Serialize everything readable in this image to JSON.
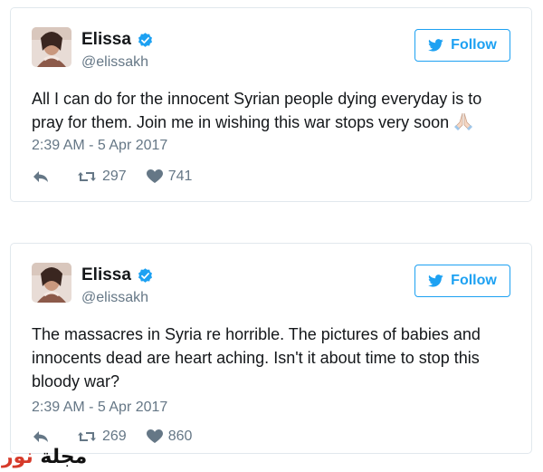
{
  "colors": {
    "accent": "#1da1f2",
    "secondary_text": "#657786",
    "border": "#e1e8ed"
  },
  "tweets": [
    {
      "user": {
        "name": "Elissa",
        "handle": "@elissakh",
        "verified": true
      },
      "follow_label": "Follow",
      "text": "All I can do for the innocent Syrian people dying everyday is to pray for them. Join me in wishing this war stops very soon",
      "emoji": "praying-hands-icon",
      "timestamp": "2:39 AM - 5 Apr 2017",
      "retweets": "297",
      "likes": "741"
    },
    {
      "user": {
        "name": "Elissa",
        "handle": "@elissakh",
        "verified": true
      },
      "follow_label": "Follow",
      "text": "The massacres in Syria re horrible. The pictures of babies and innocents dead are heart aching. Isn't it about time to stop this bloody war?",
      "timestamp": "2:39 AM - 5 Apr 2017",
      "retweets": "269",
      "likes": "860"
    }
  ],
  "watermark": {
    "part1": "مجلة",
    "part2": "نور"
  }
}
